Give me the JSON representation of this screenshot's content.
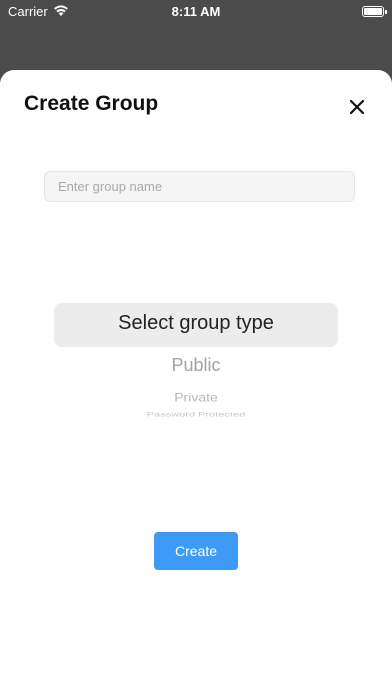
{
  "status_bar": {
    "carrier": "Carrier",
    "time": "8:11 AM"
  },
  "sheet": {
    "title": "Create Group",
    "close_icon": "close-icon",
    "group_name_input": {
      "value": "",
      "placeholder": "Enter group name"
    },
    "group_type_picker": {
      "selected": "Select group type",
      "options": [
        "Public",
        "Private",
        "Password Protected"
      ]
    },
    "create_button_label": "Create"
  },
  "colors": {
    "accent": "#3e9bf5",
    "backdrop": "#4b4b4b",
    "sheet_background": "#ffffff"
  }
}
